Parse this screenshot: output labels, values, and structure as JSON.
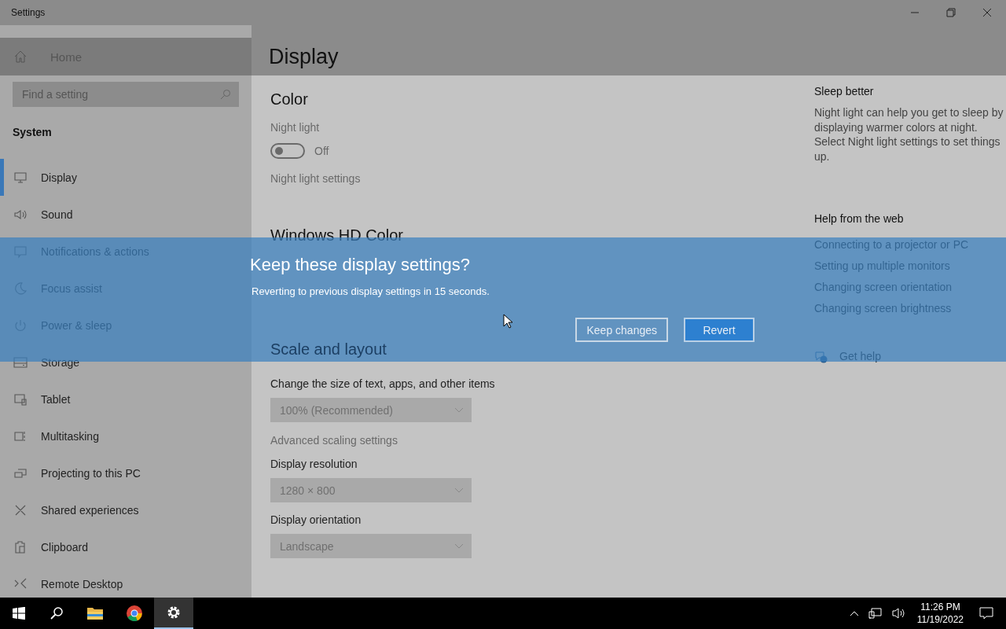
{
  "window": {
    "title": "Settings"
  },
  "sidebar": {
    "home": "Home",
    "search": {
      "placeholder": "Find a setting"
    },
    "section": "System",
    "items": [
      {
        "label": "Display",
        "selected": true
      },
      {
        "label": "Sound",
        "selected": false
      },
      {
        "label": "Notifications & actions",
        "selected": false
      },
      {
        "label": "Focus assist",
        "selected": false
      },
      {
        "label": "Power & sleep",
        "selected": false
      },
      {
        "label": "Storage",
        "selected": false
      },
      {
        "label": "Tablet",
        "selected": false
      },
      {
        "label": "Multitasking",
        "selected": false
      },
      {
        "label": "Projecting to this PC",
        "selected": false
      },
      {
        "label": "Shared experiences",
        "selected": false
      },
      {
        "label": "Clipboard",
        "selected": false
      },
      {
        "label": "Remote Desktop",
        "selected": false
      }
    ]
  },
  "main": {
    "title": "Display",
    "color": {
      "heading": "Color",
      "night_light": {
        "label": "Night light",
        "on": false,
        "state": "Off"
      },
      "settings_link": "Night light settings"
    },
    "hd_color": {
      "heading": "Windows HD Color"
    },
    "scale": {
      "heading": "Scale and layout",
      "size_label": "Change the size of text, apps, and other items",
      "size_value": "100% (Recommended)",
      "advanced_link": "Advanced scaling settings",
      "resolution_label": "Display resolution",
      "resolution_value": "1280 × 800",
      "orientation_label": "Display orientation",
      "orientation_value": "Landscape"
    }
  },
  "aside": {
    "sleep": {
      "heading": "Sleep better",
      "text": "Night light can help you get to sleep by displaying warmer colors at night. Select Night light settings to set things up."
    },
    "help": {
      "heading": "Help from the web",
      "links": [
        "Connecting to a projector or PC",
        "Setting up multiple monitors",
        "Changing screen orientation",
        "Changing screen brightness"
      ],
      "get_help": "Get help"
    }
  },
  "dialog": {
    "title": "Keep these display settings?",
    "message": "Reverting to previous display settings in 15 seconds.",
    "buttons": [
      {
        "label": "Keep changes",
        "primary": false
      },
      {
        "label": "Revert",
        "primary": true
      }
    ]
  },
  "taskbar": {
    "apps": [
      {
        "selected": false
      },
      {
        "selected": false
      },
      {
        "selected": true
      }
    ],
    "time": "11:26 PM",
    "date": "11/19/2022"
  }
}
